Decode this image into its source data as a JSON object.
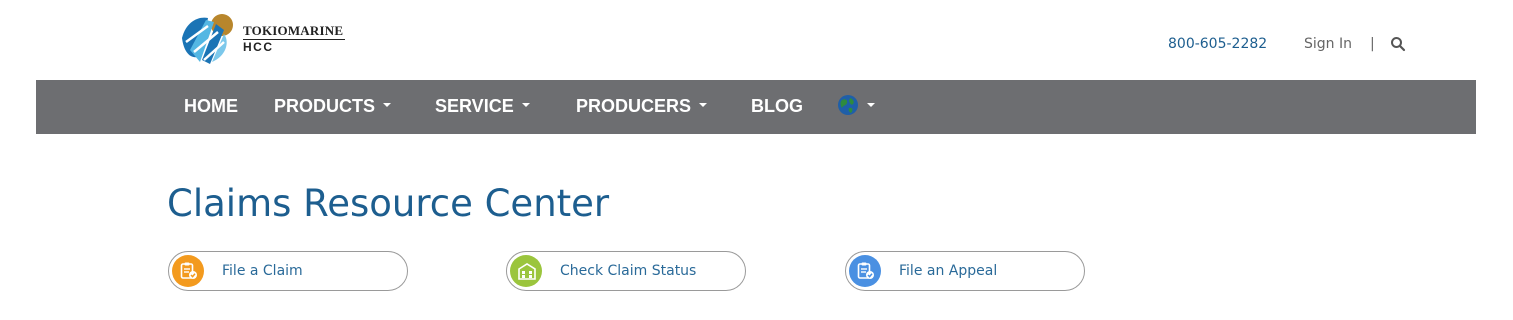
{
  "header": {
    "logo": {
      "line1": "TOKIOMARINE",
      "line2": "HCC"
    },
    "phone": "800-605-2282",
    "sign_in": "Sign In",
    "separator": "|",
    "search_icon": "search-icon"
  },
  "nav": {
    "items": [
      {
        "label": "HOME",
        "dropdown": false
      },
      {
        "label": "PRODUCTS",
        "dropdown": true
      },
      {
        "label": "SERVICE",
        "dropdown": true
      },
      {
        "label": "PRODUCERS",
        "dropdown": true
      },
      {
        "label": "BLOG",
        "dropdown": false
      }
    ],
    "language_icon": "globe-icon",
    "background": "#6d6e71"
  },
  "main": {
    "title": "Claims Resource Center",
    "actions": [
      {
        "label": "File a Claim",
        "icon": "clipboard-check-icon",
        "color": "#f39a1e"
      },
      {
        "label": "Check Claim Status",
        "icon": "building-icon",
        "color": "#9bc53d"
      },
      {
        "label": "File an Appeal",
        "icon": "clipboard-check-icon",
        "color": "#4a90e2"
      }
    ]
  },
  "colors": {
    "brand_blue": "#1d5e8f",
    "link_blue": "#2a6a99",
    "nav_gray": "#6d6e71"
  }
}
